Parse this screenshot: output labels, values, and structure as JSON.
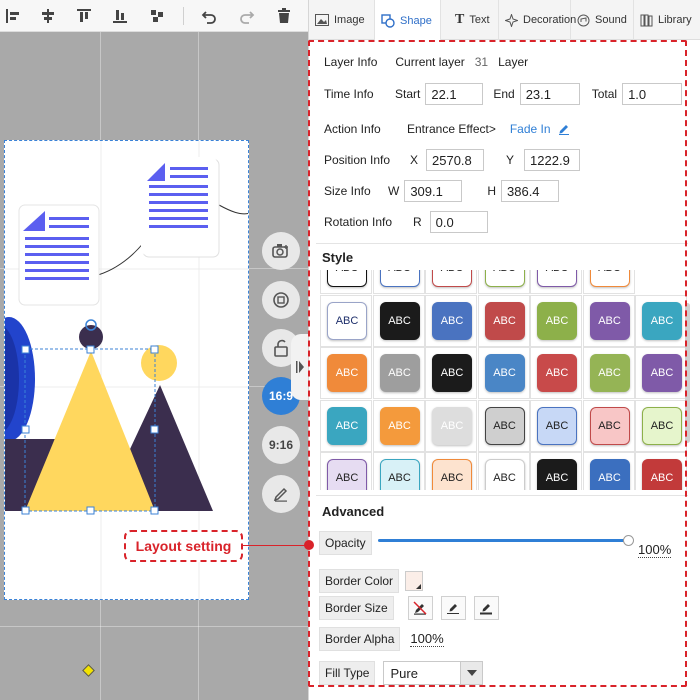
{
  "tabs": [
    {
      "label": "Image",
      "icon": "image-icon",
      "active": false
    },
    {
      "label": "Shape",
      "icon": "shape-icon",
      "active": true
    },
    {
      "label": "Text",
      "icon": "text-icon",
      "active": false
    },
    {
      "label": "Decoration",
      "icon": "decoration-icon",
      "active": false
    },
    {
      "label": "Sound",
      "icon": "sound-icon",
      "active": false
    },
    {
      "label": "Library",
      "icon": "library-icon",
      "active": false
    }
  ],
  "layer_info": {
    "label": "Layer Info",
    "current_label": "Current layer",
    "current_value": "31",
    "suffix": "Layer"
  },
  "time_info": {
    "label": "Time Info",
    "start_label": "Start",
    "start_value": "22.1",
    "end_label": "End",
    "end_value": "23.1",
    "total_label": "Total",
    "total_value": "1.0"
  },
  "action_info": {
    "label": "Action Info",
    "entrance_label": "Entrance Effect>",
    "effect_value": "Fade In"
  },
  "position_info": {
    "label": "Position Info",
    "x_label": "X",
    "x_value": "2570.8",
    "y_label": "Y",
    "y_value": "1222.9"
  },
  "size_info": {
    "label": "Size Info",
    "w_label": "W",
    "w_value": "309.1",
    "h_label": "H",
    "h_value": "386.4"
  },
  "rotation_info": {
    "label": "Rotation Info",
    "r_label": "R",
    "r_value": "0.0"
  },
  "style": {
    "title": "Style",
    "chip_text": "ABC",
    "rows": [
      [
        {
          "bg": "#ffffff",
          "fg": "#222222",
          "border": "#111111"
        },
        {
          "bg": "#ffffff",
          "fg": "#222222",
          "border": "#4a73c0"
        },
        {
          "bg": "#ffffff",
          "fg": "#222222",
          "border": "#c04a4a"
        },
        {
          "bg": "#ffffff",
          "fg": "#222222",
          "border": "#8db04a"
        },
        {
          "bg": "#ffffff",
          "fg": "#222222",
          "border": "#7f5aa8"
        },
        {
          "bg": "#ffffff",
          "fg": "#222222",
          "border": "#f08a3a"
        }
      ],
      [
        {
          "bg": "#ffffff",
          "fg": "#1e2f6b",
          "border": "#9aa4c8"
        },
        {
          "bg": "#1b1b1b",
          "fg": "#ffffff",
          "border": "#1b1b1b"
        },
        {
          "bg": "#4a73c0",
          "fg": "#ffffff",
          "border": "#4a73c0"
        },
        {
          "bg": "#c04a4a",
          "fg": "#ffffff",
          "border": "#c04a4a"
        },
        {
          "bg": "#8db04a",
          "fg": "#ffffff",
          "border": "#8db04a"
        },
        {
          "bg": "#7f5aa8",
          "fg": "#ffffff",
          "border": "#7f5aa8"
        },
        {
          "bg": "#3aa6c0",
          "fg": "#ffffff",
          "border": "#3aa6c0"
        }
      ],
      [
        {
          "bg": "#f08a3a",
          "fg": "#ffffff",
          "border": "#f08a3a"
        },
        {
          "bg": "#9e9e9e",
          "fg": "#ffffff",
          "border": "#9e9e9e"
        },
        {
          "bg": "#1b1b1b",
          "fg": "#ffffff",
          "border": "#1b1b1b"
        },
        {
          "bg": "#4a86c6",
          "fg": "#ffffff",
          "border": "#4a86c6"
        },
        {
          "bg": "#c84a4a",
          "fg": "#ffffff",
          "border": "#c84a4a"
        },
        {
          "bg": "#95b455",
          "fg": "#ffffff",
          "border": "#95b455"
        },
        {
          "bg": "#7f5aa8",
          "fg": "#ffffff",
          "border": "#7f5aa8"
        }
      ],
      [
        {
          "bg": "#3aa6c0",
          "fg": "#ffffff",
          "border": "#3aa6c0"
        },
        {
          "bg": "#f49a3c",
          "fg": "#ffffff",
          "border": "#f49a3c"
        },
        {
          "bg": "#dddddd",
          "fg": "#ffffff",
          "border": "#dddddd"
        },
        {
          "bg": "#cfcfcf",
          "fg": "#222222",
          "border": "#444444"
        },
        {
          "bg": "#c7d8f6",
          "fg": "#222222",
          "border": "#4a73c0"
        },
        {
          "bg": "#f8c6c6",
          "fg": "#222222",
          "border": "#c04a4a"
        },
        {
          "bg": "#e6f5cc",
          "fg": "#222222",
          "border": "#8db04a"
        }
      ],
      [
        {
          "bg": "#e6dcf2",
          "fg": "#222222",
          "border": "#7f5aa8"
        },
        {
          "bg": "#d8f1f7",
          "fg": "#222222",
          "border": "#3aa6c0"
        },
        {
          "bg": "#fde3cf",
          "fg": "#222222",
          "border": "#f08a3a"
        },
        {
          "bg": "#ffffff",
          "fg": "#222222",
          "border": "#cccccc"
        },
        {
          "bg": "#1b1b1b",
          "fg": "#ffffff",
          "border": "#1b1b1b"
        },
        {
          "bg": "#3b6fbf",
          "fg": "#ffffff",
          "border": "#3b6fbf"
        },
        {
          "bg": "#c23a3a",
          "fg": "#ffffff",
          "border": "#c23a3a"
        }
      ]
    ]
  },
  "advanced": {
    "title": "Advanced",
    "opacity_label": "Opacity",
    "opacity_value": "100%",
    "opacity_fraction": 1.0,
    "border_color_label": "Border Color",
    "border_size_label": "Border Size",
    "border_alpha_label": "Border Alpha",
    "border_alpha_value": "100%",
    "fill_type_label": "Fill Type",
    "fill_type_value": "Pure"
  },
  "canvas": {
    "aspect_options": [
      "16:9",
      "9:16"
    ],
    "active_aspect": "16:9"
  },
  "callout": {
    "text": "Layout setting"
  }
}
